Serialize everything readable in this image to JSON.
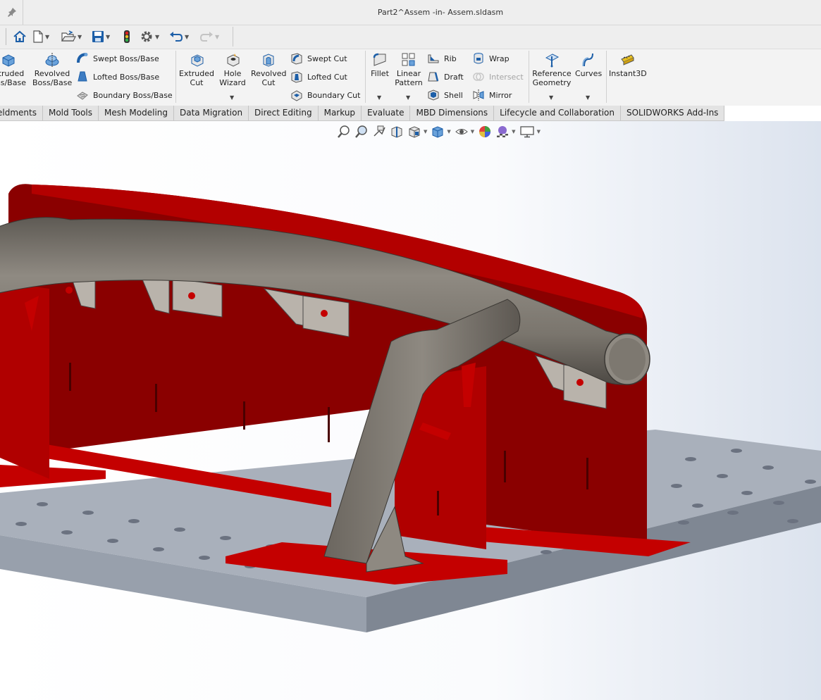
{
  "window": {
    "title": "Part2^Assem -in- Assem.sldasm"
  },
  "ribbon": {
    "extruded_boss": "truded\nss/Base",
    "revolved_boss": "Revolved\nBoss/Base",
    "swept_boss": "Swept Boss/Base",
    "lofted_boss": "Lofted Boss/Base",
    "boundary_boss": "Boundary Boss/Base",
    "extruded_cut": "Extruded\nCut",
    "hole_wizard": "Hole\nWizard",
    "revolved_cut": "Revolved\nCut",
    "swept_cut": "Swept Cut",
    "lofted_cut": "Lofted Cut",
    "boundary_cut": "Boundary Cut",
    "fillet": "Fillet",
    "linear_pattern": "Linear\nPattern",
    "rib": "Rib",
    "draft": "Draft",
    "shell": "Shell",
    "wrap": "Wrap",
    "intersect": "Intersect",
    "mirror": "Mirror",
    "reference_geometry": "Reference\nGeometry",
    "curves": "Curves",
    "instant3d": "Instant3D"
  },
  "tabs": [
    "eldments",
    "Mold Tools",
    "Mesh Modeling",
    "Data Migration",
    "Direct Editing",
    "Markup",
    "Evaluate",
    "MBD Dimensions",
    "Lifecycle and Collaboration",
    "SOLIDWORKS Add-Ins"
  ],
  "colors": {
    "accent_blue": "#2a6fb8",
    "part_red": "#a30000",
    "tube_gray": "#7d7870",
    "table_gray": "#a9b0bb"
  }
}
